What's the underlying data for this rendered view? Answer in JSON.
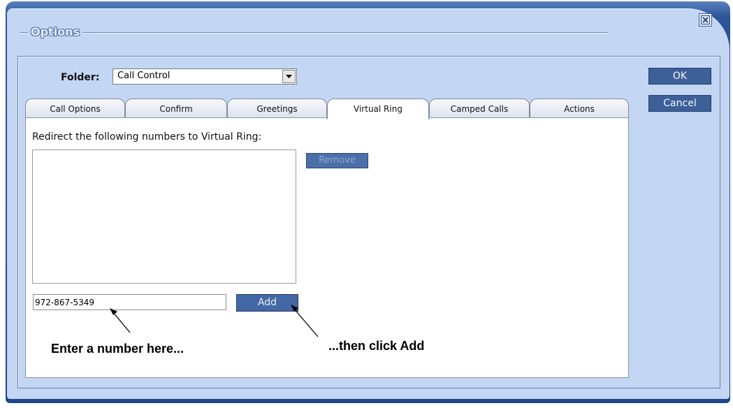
{
  "window": {
    "title": "Options",
    "close_icon": "close-icon"
  },
  "folder": {
    "label": "Folder:",
    "value": "Call Control"
  },
  "tabs": [
    {
      "label": "Call Options"
    },
    {
      "label": "Confirm"
    },
    {
      "label": "Greetings"
    },
    {
      "label": "Virtual Ring",
      "active": true
    },
    {
      "label": "Camped Calls"
    },
    {
      "label": "Actions"
    }
  ],
  "virtual_ring": {
    "redirect_label": "Redirect the following numbers to Virtual Ring:",
    "remove_label": "Remove",
    "number_value": "972-867-5349",
    "add_label": "Add"
  },
  "buttons": {
    "ok_label": "OK",
    "cancel_label": "Cancel"
  },
  "annotations": {
    "enter_number": "Enter a number here...",
    "click_add": "...then click Add"
  },
  "colors": {
    "frame": "#1e4688",
    "body": "#c3d6f4",
    "button": "#3e6098"
  }
}
